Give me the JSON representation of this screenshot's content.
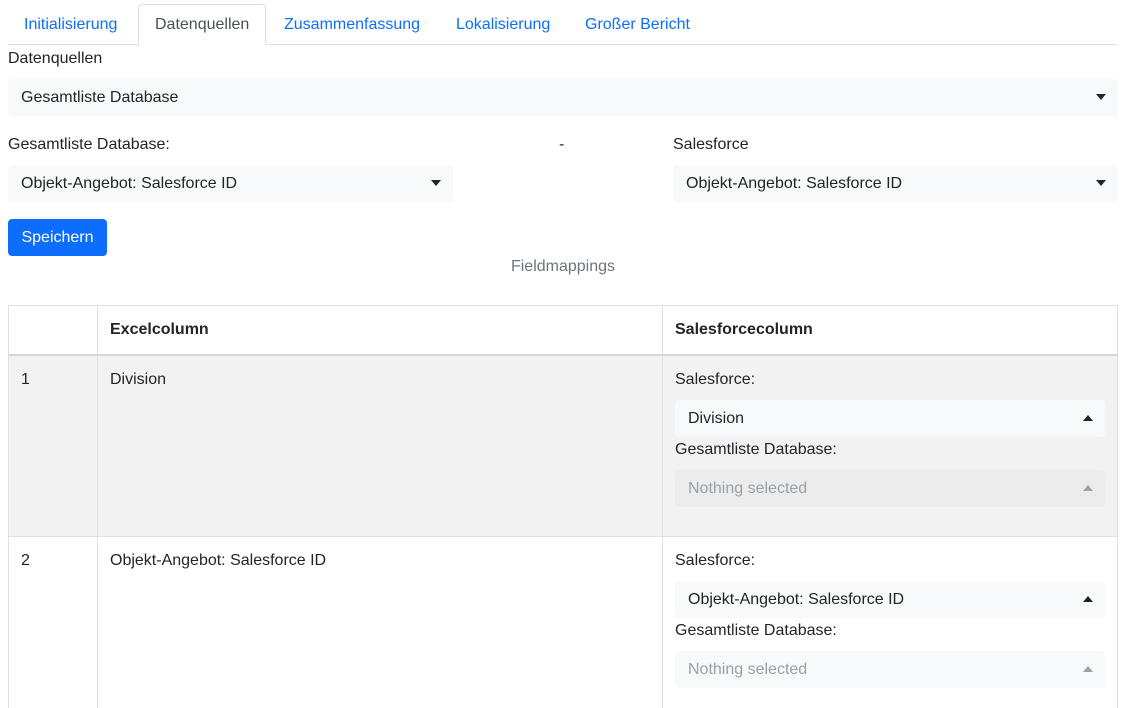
{
  "tabs": [
    {
      "label": "Initialisierung",
      "active": false
    },
    {
      "label": "Datenquellen",
      "active": true
    },
    {
      "label": "Zusammenfassung",
      "active": false
    },
    {
      "label": "Lokalisierung",
      "active": false
    },
    {
      "label": "Großer Bericht",
      "active": false
    }
  ],
  "datasource": {
    "label": "Datenquellen",
    "selected": "Gesamtliste Database"
  },
  "mapping_header": {
    "left_label": "Gesamtliste Database:",
    "separator": "-",
    "right_label": "Salesforce",
    "left_selected": "Objekt-Angebot: Salesforce ID",
    "right_selected": "Objekt-Angebot: Salesforce ID"
  },
  "save_label": "Speichern",
  "fieldmappings_caption": "Fieldmappings",
  "table": {
    "columns": [
      "",
      "Excelcolumn",
      "Salesforcecolumn"
    ],
    "rows": [
      {
        "index": "1",
        "excel": "Division",
        "sf_label": "Salesforce:",
        "sf_selected": "Division",
        "db_label": "Gesamtliste Database:",
        "db_placeholder": "Nothing selected"
      },
      {
        "index": "2",
        "excel": "Objekt-Angebot: Salesforce ID",
        "sf_label": "Salesforce:",
        "sf_selected": "Objekt-Angebot: Salesforce ID",
        "db_label": "Gesamtliste Database:",
        "db_placeholder": "Nothing selected"
      }
    ]
  },
  "colors": {
    "primary": "#0d6efd",
    "highlight_row": "#f2f2f2",
    "select_bg": "#f8f9fa",
    "border": "#dee2e6"
  }
}
